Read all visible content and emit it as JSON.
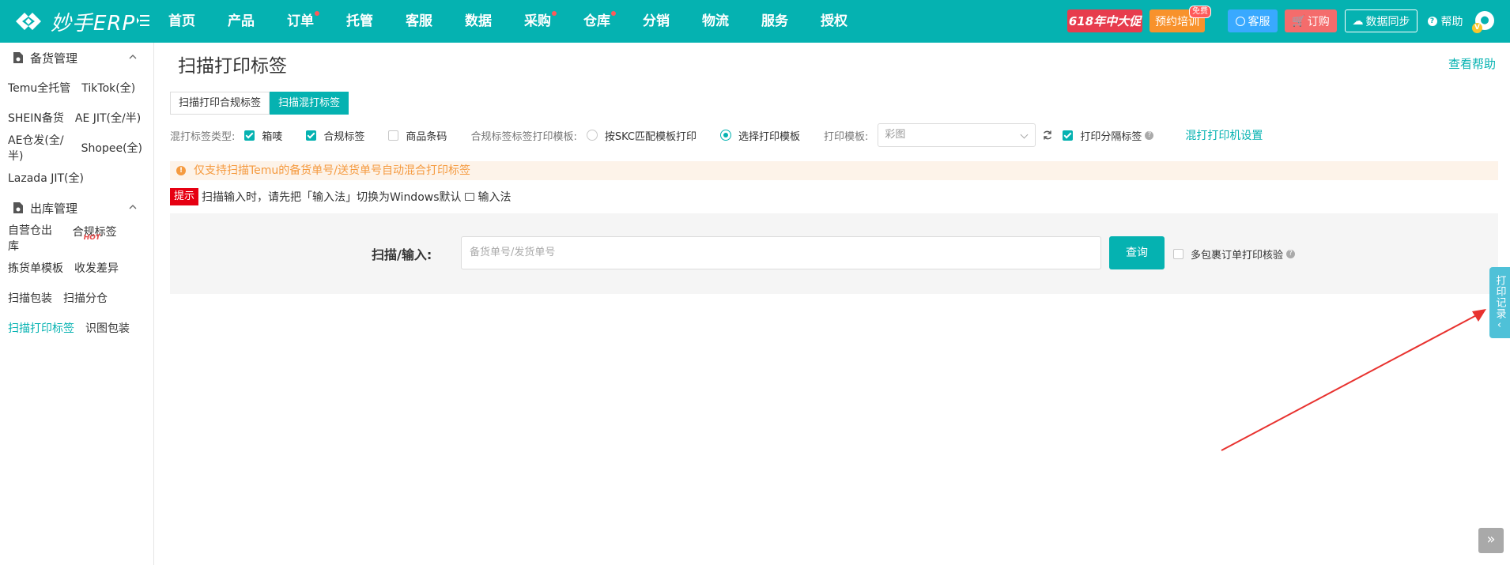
{
  "app": {
    "brand": "妙手ERP"
  },
  "nav": {
    "items": [
      {
        "label": "首页",
        "dot": false
      },
      {
        "label": "产品",
        "dot": false
      },
      {
        "label": "订单",
        "dot": true
      },
      {
        "label": "托管",
        "dot": false
      },
      {
        "label": "客服",
        "dot": false
      },
      {
        "label": "数据",
        "dot": false
      },
      {
        "label": "采购",
        "dot": true
      },
      {
        "label": "仓库",
        "dot": true
      },
      {
        "label": "分销",
        "dot": false
      },
      {
        "label": "物流",
        "dot": false
      },
      {
        "label": "服务",
        "dot": false
      },
      {
        "label": "授权",
        "dot": false
      }
    ]
  },
  "header_right": {
    "promo": "618年中大促",
    "training": "预约培训",
    "training_badge": "免费",
    "kefu": "客服",
    "order": "订购",
    "sync": "数据同步",
    "help": "帮助",
    "avatar_badge": "V"
  },
  "sidebar": {
    "section1": {
      "title": "备货管理",
      "rows": [
        [
          "Temu全托管",
          "TikTok(全)"
        ],
        [
          "SHEIN备货",
          "AE JIT(全/半)"
        ],
        [
          "AE仓发(全/半)",
          "Shopee(全)"
        ],
        [
          "Lazada JIT(全)"
        ]
      ]
    },
    "section2": {
      "title": "出库管理",
      "rows": [
        [
          "自营仓出库",
          "合规标签"
        ],
        [
          "拣货单模板",
          "收发差异"
        ],
        [
          "扫描包装",
          "扫描分仓"
        ],
        [
          "扫描打印标签",
          "识图包装"
        ]
      ],
      "hot_label": "HOT",
      "active": "扫描打印标签"
    }
  },
  "page": {
    "title": "扫描打印标签",
    "help_link": "查看帮助",
    "tabs": [
      "扫描打印合规标签",
      "扫描混打标签"
    ],
    "active_tab": 1,
    "options": {
      "type_label": "混打标签类型:",
      "type_items": [
        "箱唛",
        "合规标签",
        "商品条码"
      ],
      "type_checked": [
        true,
        true,
        false
      ],
      "tmpl_label": "合规标签标签打印模板:",
      "radio_items": [
        "按SKC匹配模板打印",
        "选择打印模板"
      ],
      "radio_selected": 1,
      "print_tmpl_label": "打印模板:",
      "print_tmpl_value": "彩图",
      "sep_label": "打印分隔标签",
      "mix_setting": "混打打印机设置"
    },
    "notice": "仅支持扫描Temu的备货单号/送货单号自动混合打印标签",
    "tip": {
      "tag": "提示",
      "text_before": "扫描输入时，请先把「输入法」切换为Windows默认",
      "text_after": "输入法"
    },
    "scan": {
      "label": "扫描/输入:",
      "placeholder": "备货单号/发货单号",
      "query_btn": "查询",
      "multi_label": "多包裹订单打印核验"
    },
    "side_tab": "打印记录"
  },
  "colors": {
    "primary": "#05b2b1",
    "promo": "#e73c4d",
    "notice_text": "#f59a3f",
    "arrow": "#e8322f"
  }
}
